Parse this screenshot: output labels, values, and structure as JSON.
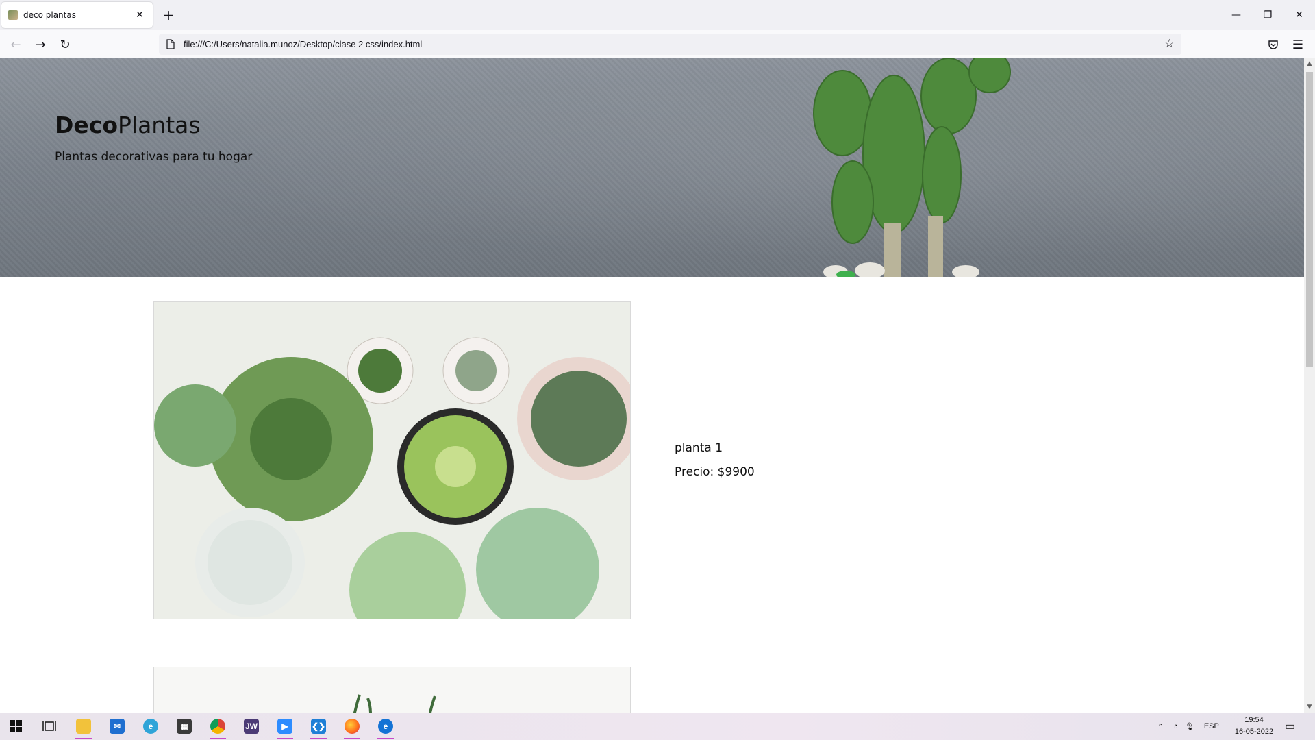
{
  "browser": {
    "tab_title": "deco plantas",
    "url": "file:///C:/Users/natalia.munoz/Desktop/clase 2 css/index.html"
  },
  "page": {
    "brand_bold": "Deco",
    "brand_regular": "Plantas",
    "tagline": "Plantas decorativas para tu hogar",
    "product": {
      "name": "planta 1",
      "price": "Precio: $9900"
    }
  },
  "taskbar": {
    "apps": [
      "start-icon",
      "task-view-icon",
      "file-explorer-icon",
      "mail-icon",
      "internet-explorer-icon",
      "store-icon",
      "chrome-icon",
      "jw-player-icon",
      "zoom-icon",
      "vscode-icon",
      "firefox-icon",
      "edge-icon"
    ],
    "language": "ESP",
    "time": "19:54",
    "date": "16-05-2022"
  },
  "colors": {
    "chrome_bg": "#f0f0f4",
    "hero_wall": "#7b828b",
    "taskbar_accent": "#c74bc8"
  }
}
